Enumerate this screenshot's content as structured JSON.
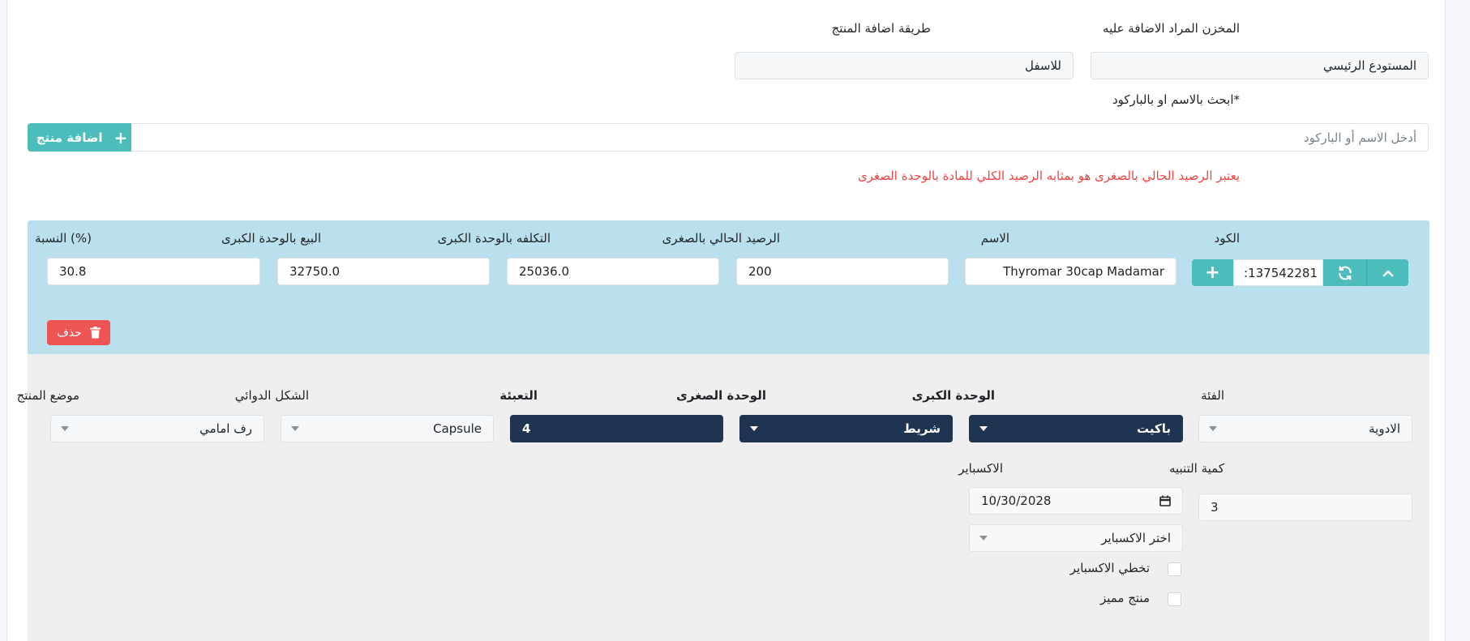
{
  "warehouse": {
    "label": "المخزن المراد الاضافة عليه",
    "value": "المستودع الرئيسي"
  },
  "add_method": {
    "label": "طريقة اضافة المنتج",
    "value": "للاسفل"
  },
  "search": {
    "label": "ابحث بالاسم او بالباركود*",
    "placeholder": "أدخل الاسم أو الباركود",
    "add_button": "اضافة منتج"
  },
  "notice": "يعتبر الرصيد الحالي بالصغرى هو بمثابه الرصيد الكلي للمادة بالوحدة الصغرى",
  "product": {
    "code_label": "الكود",
    "code_value": "137542281:",
    "name_label": "الاسم",
    "name_value": "Thyromar 30cap Madamar",
    "balance_label": "الرصيد الحالي بالصغرى",
    "balance_value": "200",
    "cost_label": "التكلفه بالوحدة الكبرى",
    "cost_value": "25036.0",
    "sale_label": "البيع بالوحدة الكبرى",
    "sale_value": "32750.0",
    "ratio_label": "النسبة (%)",
    "ratio_value": "30.8",
    "delete_button": "حذف"
  },
  "details": {
    "category_label": "الفئة",
    "category_value": "الادوية",
    "major_unit_label": "الوحدة الكبرى",
    "major_unit_value": "باكيت",
    "minor_unit_label": "الوحدة الصغرى",
    "minor_unit_value": "شريط",
    "pack_label": "التعبئة",
    "pack_value": "4",
    "dosage_form_label": "الشكل الدوائي",
    "dosage_form_value": "Capsule",
    "position_label": "موضع المنتج",
    "position_value": "رف امامي",
    "alert_qty_label": "كمية التنبيه",
    "alert_qty_value": "3",
    "expiry_label": "الاكسباير",
    "expiry_date": "10/30/2028",
    "expiry_select": "اختر الاكسباير",
    "skip_expiry_label": "تخطي الاكسباير",
    "featured_label": "منتج مميز"
  },
  "colors": {
    "teal": "#4cbdba",
    "product_row_bg": "#b9e0ec",
    "details_bg": "#efefef",
    "dark_select": "#1f3450",
    "danger": "#ef5454",
    "notice_text": "#ef4444"
  },
  "icons": [
    "plus-icon",
    "refresh-icon",
    "chevron-up-icon",
    "trash-icon",
    "calendar-icon",
    "caret-down-icon"
  ]
}
